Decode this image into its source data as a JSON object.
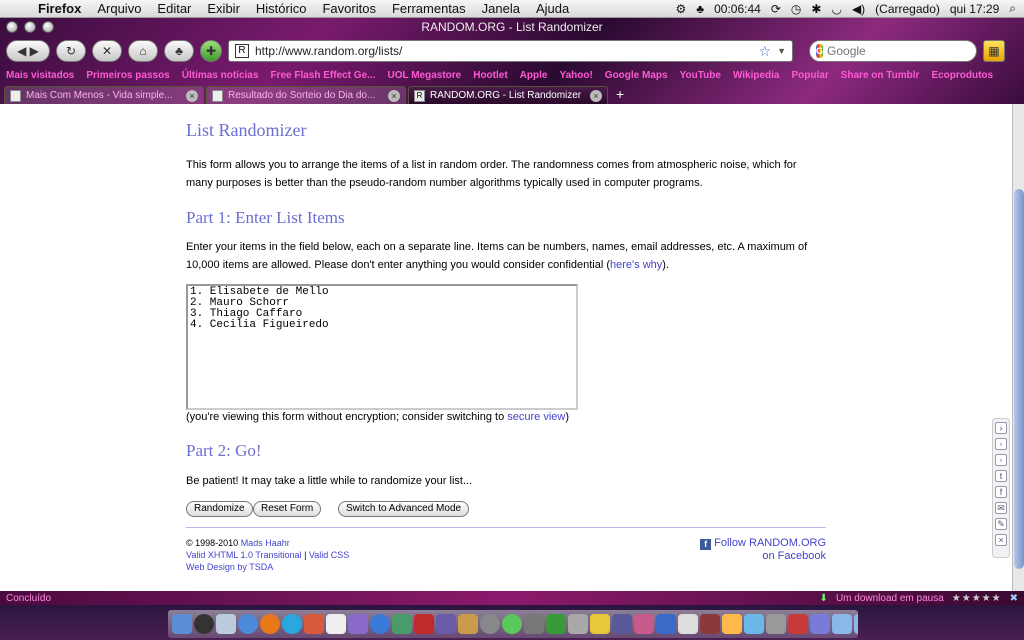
{
  "menubar": {
    "app": "Firefox",
    "items": [
      "Arquivo",
      "Editar",
      "Exibir",
      "Histórico",
      "Favoritos",
      "Ferramentas",
      "Janela",
      "Ajuda"
    ],
    "timer": "00:06:44",
    "battery": "(Carregado)",
    "clock": "qui 17:29"
  },
  "window": {
    "title": "RANDOM.ORG - List Randomizer"
  },
  "navbar": {
    "url": "http://www.random.org/lists/",
    "search_placeholder": "Google"
  },
  "bookmarks": [
    "Mais visitados",
    "Primeiros passos",
    "Últimas notícias",
    "Free Flash Effect Ge...",
    "UOL Megastore",
    "Hootlet",
    "Apple",
    "Yahoo!",
    "Google Maps",
    "YouTube",
    "Wikipedia",
    "Popular",
    "Share on Tumblr",
    "Ecoprodutos"
  ],
  "tabs": [
    {
      "label": "Mais Com Menos - Vida simple...",
      "icon": "page-icon"
    },
    {
      "label": "Resultado do Sorteio do Dia do...",
      "icon": "page-icon"
    },
    {
      "label": "RANDOM.ORG - List Randomizer",
      "icon": "random-org-icon"
    }
  ],
  "page": {
    "title": "List Randomizer",
    "intro": "This form allows you to arrange the items of a list in random order. The randomness comes from atmospheric noise, which for many purposes is better than the pseudo-random number algorithms typically used in computer programs.",
    "part1_heading": "Part 1: Enter List Items",
    "part1_text": "Enter your items in the field below, each on a separate line. Items can be numbers, names, email addresses, etc. A maximum of 10,000 items are allowed. Please don't enter anything you would consider confidential (",
    "part1_link": "here's why",
    "part1_text_end": ").",
    "list_value": "1. Elisabete de Mello\n2. Mauro Schorr\n3. Thiago Caffaro\n4. Cecilia Figueiredo",
    "encryption_text": "(you're viewing this form without encryption; consider switching to ",
    "encryption_link": "secure view",
    "encryption_end": ")",
    "part2_heading": "Part 2: Go!",
    "part2_text": "Be patient! It may take a little while to randomize your list...",
    "buttons": {
      "randomize": "Randomize",
      "reset": "Reset Form",
      "advanced": "Switch to Advanced Mode"
    },
    "footer": {
      "copyright": "© 1998-2010 ",
      "author": "Mads Haahr",
      "valid_xhtml": "Valid XHTML 1.0 Transitional",
      "separator": " | ",
      "valid_css": "Valid CSS",
      "design": "Web Design by TSDA"
    },
    "facebook": {
      "line1": "Follow RANDOM.ORG",
      "line2": "on Facebook"
    }
  },
  "statusbar": {
    "left": "Concluído",
    "download": "Um download em pausa"
  },
  "colors": {
    "heading": "#6b6fcf",
    "link": "#4444cc",
    "bookmark": "#ff5ad4"
  }
}
